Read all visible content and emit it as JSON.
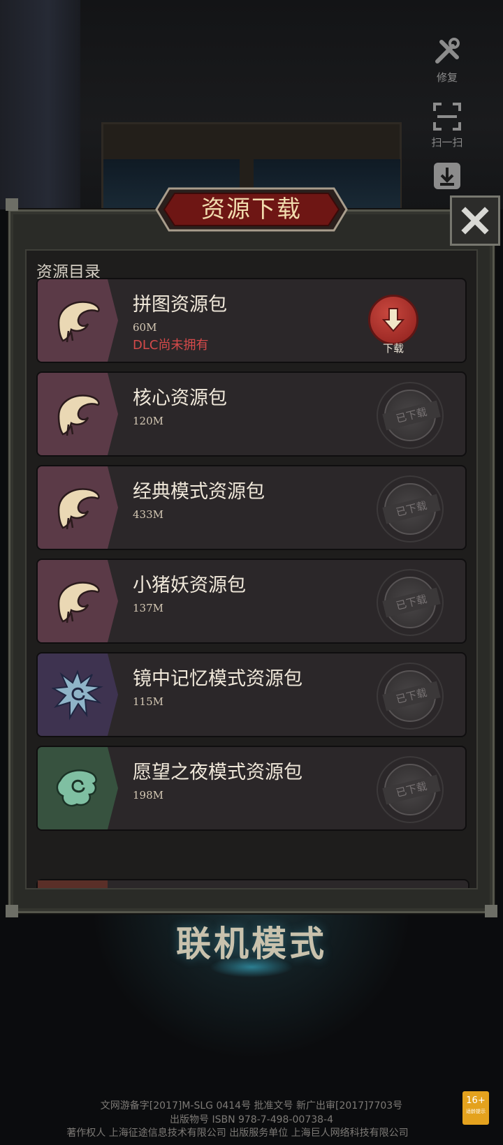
{
  "side_tools": [
    {
      "label": "修复",
      "icon": "repair-tools-icon"
    },
    {
      "label": "扫一扫",
      "icon": "scan-icon"
    },
    {
      "label": "",
      "icon": "download-icon"
    }
  ],
  "modal": {
    "title": "资源下载",
    "close_icon": "close-icon",
    "catalog_title": "资源目录"
  },
  "packs": [
    {
      "name": "拼图资源包",
      "size": "60M",
      "status_text": "DLC尚未拥有",
      "action": "下载",
      "downloaded": false,
      "icon": "crescent-leaf-icon",
      "icon_bg": "#5b3a47"
    },
    {
      "name": "核心资源包",
      "size": "120M",
      "action": "已下载",
      "downloaded": true,
      "icon": "crescent-leaf-icon",
      "icon_bg": "#5b3a47"
    },
    {
      "name": "经典模式资源包",
      "size": "433M",
      "action": "已下载",
      "downloaded": true,
      "icon": "crescent-leaf-icon",
      "icon_bg": "#5b3a47"
    },
    {
      "name": "小猪妖资源包",
      "size": "137M",
      "action": "已下载",
      "downloaded": true,
      "icon": "crescent-leaf-icon",
      "icon_bg": "#5b3a47"
    },
    {
      "name": "镜中记忆模式资源包",
      "size": "115M",
      "action": "已下载",
      "downloaded": true,
      "icon": "spiky-swirl-icon",
      "icon_bg": "#3e3350"
    },
    {
      "name": "愿望之夜模式资源包",
      "size": "198M",
      "action": "已下载",
      "downloaded": true,
      "icon": "leaf-swirl-icon",
      "icon_bg": "#37523f"
    }
  ],
  "background": {
    "mode_banner": "联机模式"
  },
  "footer": {
    "line1": "文网游备字[2017]M-SLG 0414号 批准文号 新广出审[2017]7703号",
    "line2": "出版物号 ISBN 978-7-498-00738-4",
    "line3": "著作权人 上海征途信息技术有限公司          出版服务单位 上海巨人网络科技有限公司",
    "age_rating": "16+",
    "age_rating_sub": "适龄提示"
  }
}
